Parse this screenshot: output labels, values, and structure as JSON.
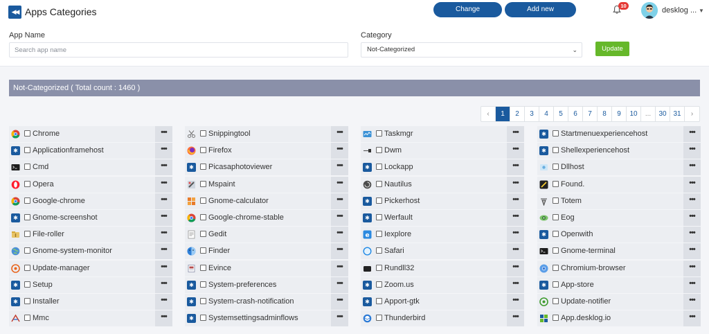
{
  "header": {
    "title": "Apps Categories",
    "change_label": "Change categories",
    "add_label": "Add new categories",
    "notification_count": "10",
    "user_name": "desklog ..."
  },
  "filter": {
    "app_name_label": "App Name",
    "search_placeholder": "Search app name",
    "category_label": "Category",
    "category_selected": "Not-Categorized",
    "update_label": "Update"
  },
  "section": {
    "title": "Not-Categorized ( Total count : 1460 )"
  },
  "pagination": [
    "‹",
    "1",
    "2",
    "3",
    "4",
    "5",
    "6",
    "7",
    "8",
    "9",
    "10",
    "...",
    "30",
    "31",
    "›"
  ],
  "more_label": "•••",
  "colors": {
    "primary": "#1a5a9e",
    "update": "#66b82a",
    "section_header": "#8a90a9",
    "badge": "#e53935"
  },
  "columns": [
    [
      {
        "name": "Chrome",
        "icon": "chrome-icon"
      },
      {
        "name": "Applicationframehost",
        "icon": "puzzle-icon"
      },
      {
        "name": "Cmd",
        "icon": "terminal-icon"
      },
      {
        "name": "Opera",
        "icon": "opera-icon"
      },
      {
        "name": "Google-chrome",
        "icon": "chrome-icon"
      },
      {
        "name": "Gnome-screenshot",
        "icon": "puzzle-icon"
      },
      {
        "name": "File-roller",
        "icon": "archive-icon"
      },
      {
        "name": "Gnome-system-monitor",
        "icon": "globe-icon"
      },
      {
        "name": "Update-manager",
        "icon": "update-icon"
      },
      {
        "name": "Setup",
        "icon": "puzzle-icon"
      },
      {
        "name": "Installer",
        "icon": "puzzle-icon"
      },
      {
        "name": "Mmc",
        "icon": "mmc-icon"
      }
    ],
    [
      {
        "name": "Snippingtool",
        "icon": "scissors-icon"
      },
      {
        "name": "Firefox",
        "icon": "firefox-icon"
      },
      {
        "name": "Picasaphotoviewer",
        "icon": "puzzle-icon"
      },
      {
        "name": "Mspaint",
        "icon": "paint-icon"
      },
      {
        "name": "Gnome-calculator",
        "icon": "calculator-icon"
      },
      {
        "name": "Google-chrome-stable",
        "icon": "chrome-icon"
      },
      {
        "name": "Gedit",
        "icon": "text-editor-icon"
      },
      {
        "name": "Finder",
        "icon": "finder-icon"
      },
      {
        "name": "Evince",
        "icon": "document-viewer-icon"
      },
      {
        "name": "System-preferences",
        "icon": "puzzle-icon"
      },
      {
        "name": "System-crash-notification",
        "icon": "puzzle-icon"
      },
      {
        "name": "Systemsettingsadminflows",
        "icon": "puzzle-icon"
      }
    ],
    [
      {
        "name": "Taskmgr",
        "icon": "task-manager-icon"
      },
      {
        "name": "Dwm",
        "icon": "dwm-icon"
      },
      {
        "name": "Lockapp",
        "icon": "puzzle-icon"
      },
      {
        "name": "Nautilus",
        "icon": "nautilus-icon"
      },
      {
        "name": "Pickerhost",
        "icon": "puzzle-icon"
      },
      {
        "name": "Werfault",
        "icon": "puzzle-icon"
      },
      {
        "name": "Iexplore",
        "icon": "ie-icon"
      },
      {
        "name": "Safari",
        "icon": "safari-icon"
      },
      {
        "name": "Rundll32",
        "icon": "rundll-icon"
      },
      {
        "name": "Zoom.us",
        "icon": "puzzle-icon"
      },
      {
        "name": "Apport-gtk",
        "icon": "puzzle-icon"
      },
      {
        "name": "Thunderbird",
        "icon": "thunderbird-icon"
      }
    ],
    [
      {
        "name": "Startmenuexperiencehost",
        "icon": "puzzle-icon"
      },
      {
        "name": "Shellexperiencehost",
        "icon": "puzzle-icon"
      },
      {
        "name": "Dllhost",
        "icon": "dllhost-icon"
      },
      {
        "name": "Found.",
        "icon": "found-icon"
      },
      {
        "name": "Totem",
        "icon": "totem-icon"
      },
      {
        "name": "Eog",
        "icon": "eye-icon"
      },
      {
        "name": "Openwith",
        "icon": "puzzle-icon"
      },
      {
        "name": "Gnome-terminal",
        "icon": "terminal-icon"
      },
      {
        "name": "Chromium-browser",
        "icon": "chromium-icon"
      },
      {
        "name": "App-store",
        "icon": "puzzle-icon"
      },
      {
        "name": "Update-notifier",
        "icon": "update-notifier-icon"
      },
      {
        "name": "App.desklog.io",
        "icon": "desklog-icon"
      }
    ]
  ]
}
